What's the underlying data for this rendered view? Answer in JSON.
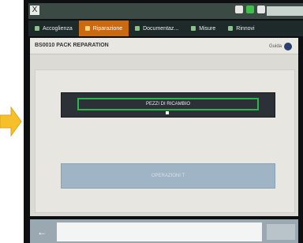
{
  "indicator": {
    "arrow_color": "#f6c02a",
    "icon": "arrow-right-icon"
  },
  "system_bar": {
    "close_label": "X",
    "clock_label": ""
  },
  "tabs": [
    {
      "label": "Accoglienza",
      "active": false
    },
    {
      "label": "Riparazione",
      "active": true
    },
    {
      "label": "Documentaz...",
      "active": false
    },
    {
      "label": "Misure",
      "active": false
    },
    {
      "label": "Rinnovi",
      "active": false
    }
  ],
  "screen": {
    "title": "BS0010 PACK REPARATION",
    "help_label": "Guida"
  },
  "buttons": {
    "pezzi_label": "PEZZI DI RICAMBIO",
    "second_label": "OPERAZIONI T"
  },
  "footer": {
    "back_icon": "back-arrow-icon"
  },
  "colors": {
    "highlight": "#2eb24a",
    "active_tab": "#c96a10"
  }
}
